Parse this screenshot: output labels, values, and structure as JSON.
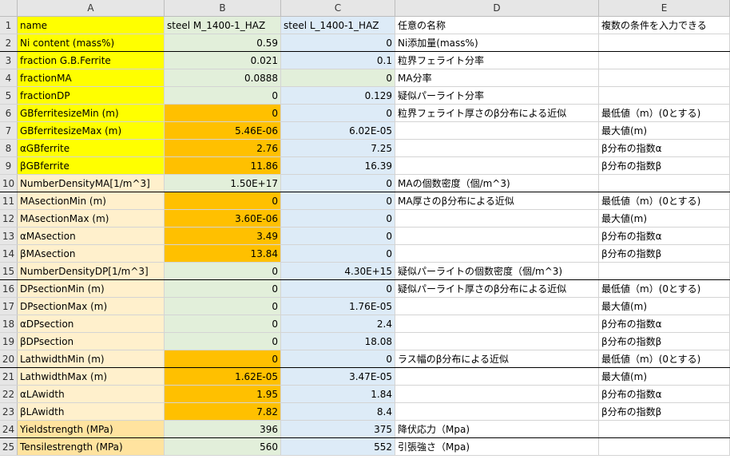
{
  "columns": [
    "A",
    "B",
    "C",
    "D",
    "E"
  ],
  "rows": [
    {
      "n": "1",
      "a": "name",
      "b": "steel M_1400-1_HAZ",
      "c": "steel L_1400-1_HAZ",
      "d": "任意の名称",
      "e": "複数の条件を入力できる"
    },
    {
      "n": "2",
      "a": "Ni content (mass%)",
      "b": "0.59",
      "c": "0",
      "d": "Ni添加量(mass%)",
      "e": ""
    },
    {
      "n": "3",
      "a": "fraction G.B.Ferrite",
      "b": "0.021",
      "c": "0.1",
      "d": "粒界フェライト分率",
      "e": ""
    },
    {
      "n": "4",
      "a": "fractionMA",
      "b": "0.0888",
      "c": "0",
      "d": "MA分率",
      "e": ""
    },
    {
      "n": "5",
      "a": "fractionDP",
      "b": "0",
      "c": "0.129",
      "d": "疑似パーライト分率",
      "e": ""
    },
    {
      "n": "6",
      "a": "GBferritesizeMin (m)",
      "b": "0",
      "c": "0",
      "d": "粒界フェライト厚さのβ分布による近似",
      "e": "最低値（m）(0とする)"
    },
    {
      "n": "7",
      "a": "GBferritesizeMax (m)",
      "b": "5.46E-06",
      "c": "6.02E-05",
      "d": "",
      "e": "最大値(m)"
    },
    {
      "n": "8",
      "a": "αGBferrite",
      "b": "2.76",
      "c": "7.25",
      "d": "",
      "e": "β分布の指数α"
    },
    {
      "n": "9",
      "a": "βGBferrite",
      "b": "11.86",
      "c": "16.39",
      "d": "",
      "e": "β分布の指数β"
    },
    {
      "n": "10",
      "a": "NumberDensityMA[1/m^3]",
      "b": "1.50E+17",
      "c": "0",
      "d": "MAの個数密度（個/m^3)",
      "e": ""
    },
    {
      "n": "11",
      "a": "MAsectionMin (m)",
      "b": "0",
      "c": "0",
      "d": "MA厚さのβ分布による近似",
      "e": "最低値（m）(0とする)"
    },
    {
      "n": "12",
      "a": "MAsectionMax (m)",
      "b": "3.60E-06",
      "c": "0",
      "d": "",
      "e": "最大値(m)"
    },
    {
      "n": "13",
      "a": "αMAsection",
      "b": "3.49",
      "c": "0",
      "d": "",
      "e": "β分布の指数α"
    },
    {
      "n": "14",
      "a": "βMAsection",
      "b": "13.84",
      "c": "0",
      "d": "",
      "e": "β分布の指数β"
    },
    {
      "n": "15",
      "a": "NumberDensityDP[1/m^3]",
      "b": "0",
      "c": "4.30E+15",
      "d": "疑似パーライトの個数密度（個/m^3)",
      "e": ""
    },
    {
      "n": "16",
      "a": "DPsectionMin (m)",
      "b": "0",
      "c": "0",
      "d": "疑似パーライト厚さのβ分布による近似",
      "e": "最低値（m）(0とする)"
    },
    {
      "n": "17",
      "a": "DPsectionMax (m)",
      "b": "0",
      "c": "1.76E-05",
      "d": "",
      "e": "最大値(m)"
    },
    {
      "n": "18",
      "a": "αDPsection",
      "b": "0",
      "c": "2.4",
      "d": "",
      "e": "β分布の指数α"
    },
    {
      "n": "19",
      "a": "βDPsection",
      "b": "0",
      "c": "18.08",
      "d": "",
      "e": "β分布の指数β"
    },
    {
      "n": "20",
      "a": "LathwidthMin (m)",
      "b": "0",
      "c": "0",
      "d": "ラス幅のβ分布による近似",
      "e": "最低値（m）(0とする)"
    },
    {
      "n": "21",
      "a": "LathwidthMax (m)",
      "b": "1.62E-05",
      "c": "3.47E-05",
      "d": "",
      "e": "最大値(m)"
    },
    {
      "n": "22",
      "a": "αLAwidth",
      "b": "1.95",
      "c": "1.84",
      "d": "",
      "e": "β分布の指数α"
    },
    {
      "n": "23",
      "a": "βLAwidth",
      "b": "7.82",
      "c": "8.4",
      "d": "",
      "e": "β分布の指数β"
    },
    {
      "n": "24",
      "a": "Yieldstrength (MPa)",
      "b": "396",
      "c": "375",
      "d": "降伏応力（Mpa)",
      "e": ""
    },
    {
      "n": "25",
      "a": "Tensilestrength (MPa)",
      "b": "560",
      "c": "552",
      "d": "引張強さ（Mpa)",
      "e": ""
    }
  ],
  "colors": {
    "yellow": "#ffff00",
    "peach": "#fff0cc",
    "tan": "#ffe39f",
    "orange": "#ffc000",
    "green": "#e2efda",
    "blue": "#ddebf7",
    "white": "#ffffff"
  }
}
